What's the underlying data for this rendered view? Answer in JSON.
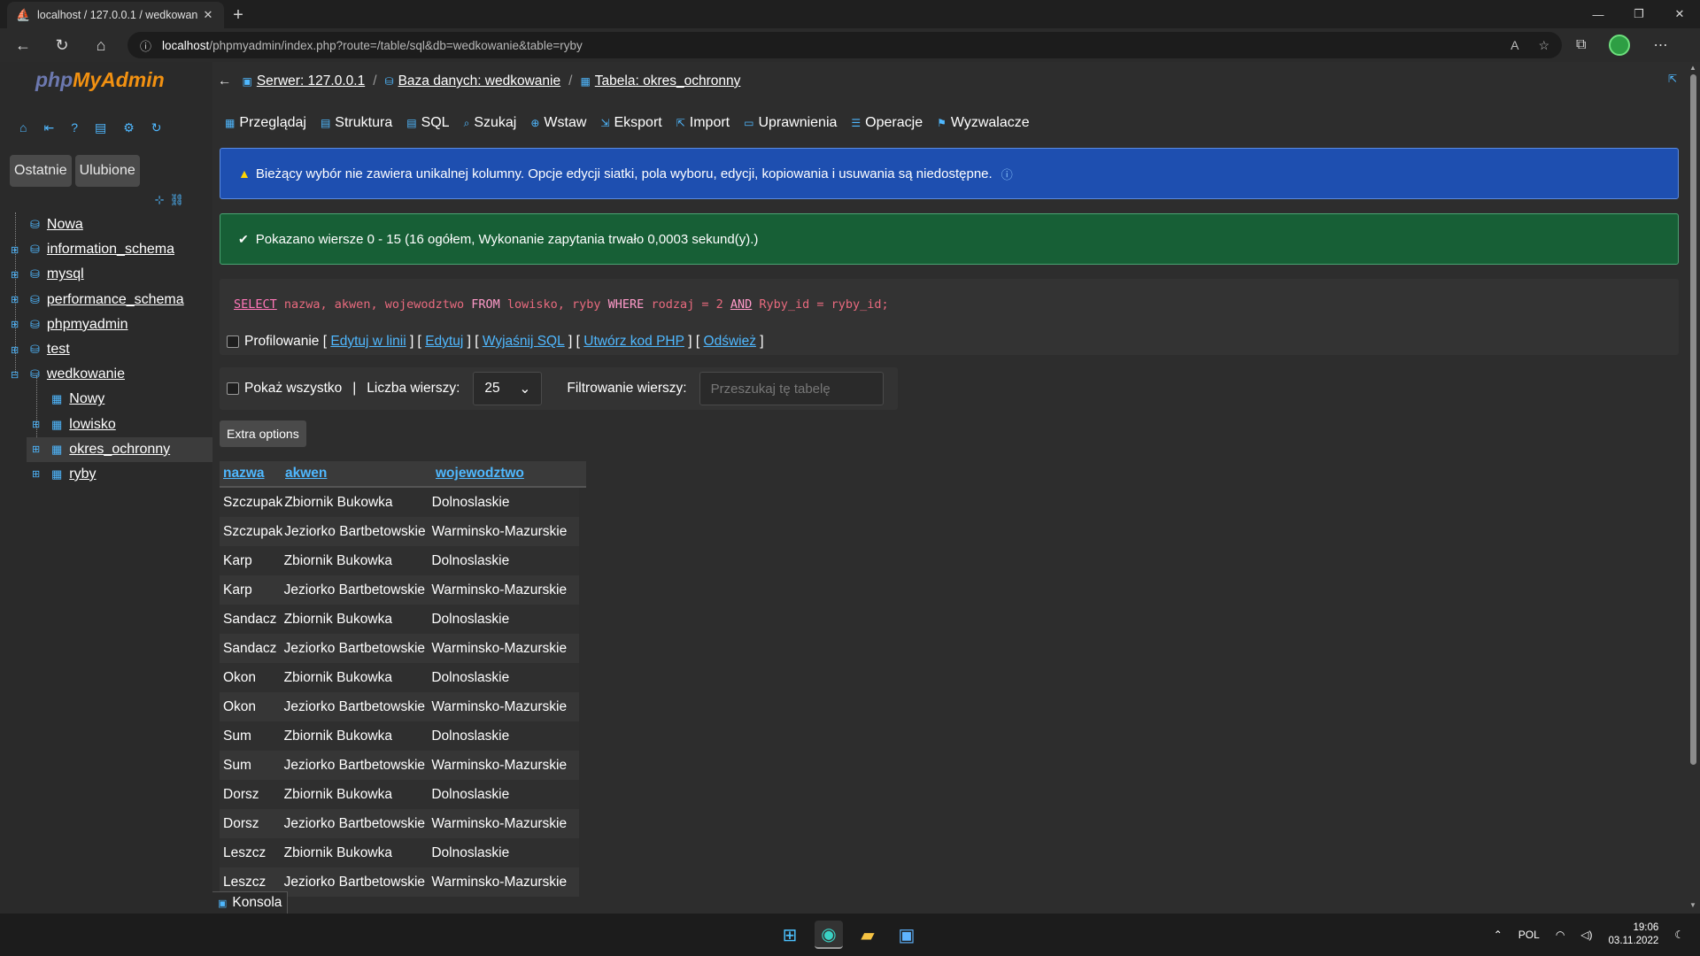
{
  "browser": {
    "tab_title": "localhost / 127.0.0.1 / wedkowan",
    "url_host": "localhost",
    "url_path": "/phpmyadmin/index.php?route=/table/sql&db=wedkowanie&table=ryby"
  },
  "sidebar": {
    "logo_php": "php",
    "logo_my": "MyAdmin",
    "tabs": [
      "Ostatnie",
      "Ulubione"
    ],
    "tree": [
      {
        "label": "Nowa"
      },
      {
        "label": "information_schema"
      },
      {
        "label": "mysql"
      },
      {
        "label": "performance_schema"
      },
      {
        "label": "phpmyadmin"
      },
      {
        "label": "test"
      },
      {
        "label": "wedkowanie"
      },
      {
        "label": "Nowy"
      },
      {
        "label": "lowisko"
      },
      {
        "label": "okres_ochronny"
      },
      {
        "label": "ryby"
      }
    ]
  },
  "breadcrumb": {
    "server": "Serwer: 127.0.0.1",
    "database": "Baza danych: wedkowanie",
    "table": "Tabela: okres_ochronny"
  },
  "menu": [
    "Przeglądaj",
    "Struktura",
    "SQL",
    "Szukaj",
    "Wstaw",
    "Eksport",
    "Import",
    "Uprawnienia",
    "Operacje",
    "Wyzwalacze"
  ],
  "alerts": {
    "info": "Bieżący wybór nie zawiera unikalnej kolumny. Opcje edycji siatki, pola wyboru, edycji, kopiowania i usuwania są niedostępne.",
    "success": "Pokazano wiersze 0 - 15 (16 ogółem, Wykonanie zapytania trwało 0,0003 sekund(y).)"
  },
  "sql": {
    "select": "SELECT",
    "part1": " nazwa, akwen, wojewodztwo ",
    "from": "FROM",
    "part2": " lowisko, ryby ",
    "where": "WHERE",
    "part3": " rodzaj = 2 ",
    "and": "AND",
    "part4": " Ryby_id = ryby_id;",
    "profiling": "Profilowanie",
    "links": [
      "Edytuj w linii",
      "Edytuj",
      "Wyjaśnij SQL",
      "Utwórz kod PHP",
      "Odśwież"
    ]
  },
  "filter": {
    "show_all": "Pokaż wszystko",
    "rows_label": "Liczba wierszy:",
    "rows_value": "25",
    "filter_label": "Filtrowanie wierszy:",
    "filter_placeholder": "Przeszukaj tę tabelę"
  },
  "extra_options": "Extra options",
  "table": {
    "columns": [
      "nazwa",
      "akwen",
      "wojewodztwo"
    ],
    "rows": [
      [
        "Szczupak",
        "Zbiornik Bukowka",
        "Dolnoslaskie"
      ],
      [
        "Szczupak",
        "Jeziorko Bartbetowskie",
        "Warminsko-Mazurskie"
      ],
      [
        "Karp",
        "Zbiornik Bukowka",
        "Dolnoslaskie"
      ],
      [
        "Karp",
        "Jeziorko Bartbetowskie",
        "Warminsko-Mazurskie"
      ],
      [
        "Sandacz",
        "Zbiornik Bukowka",
        "Dolnoslaskie"
      ],
      [
        "Sandacz",
        "Jeziorko Bartbetowskie",
        "Warminsko-Mazurskie"
      ],
      [
        "Okon",
        "Zbiornik Bukowka",
        "Dolnoslaskie"
      ],
      [
        "Okon",
        "Jeziorko Bartbetowskie",
        "Warminsko-Mazurskie"
      ],
      [
        "Sum",
        "Zbiornik Bukowka",
        "Dolnoslaskie"
      ],
      [
        "Sum",
        "Jeziorko Bartbetowskie",
        "Warminsko-Mazurskie"
      ],
      [
        "Dorsz",
        "Zbiornik Bukowka",
        "Dolnoslaskie"
      ],
      [
        "Dorsz",
        "Jeziorko Bartbetowskie",
        "Warminsko-Mazurskie"
      ],
      [
        "Leszcz",
        "Zbiornik Bukowka",
        "Dolnoslaskie"
      ],
      [
        "Leszcz",
        "Jeziorko Bartbetowskie",
        "Warminsko-Mazurskie"
      ]
    ]
  },
  "console": "Konsola",
  "taskbar": {
    "lang": "POL",
    "time": "19:06",
    "date": "03.11.2022"
  }
}
